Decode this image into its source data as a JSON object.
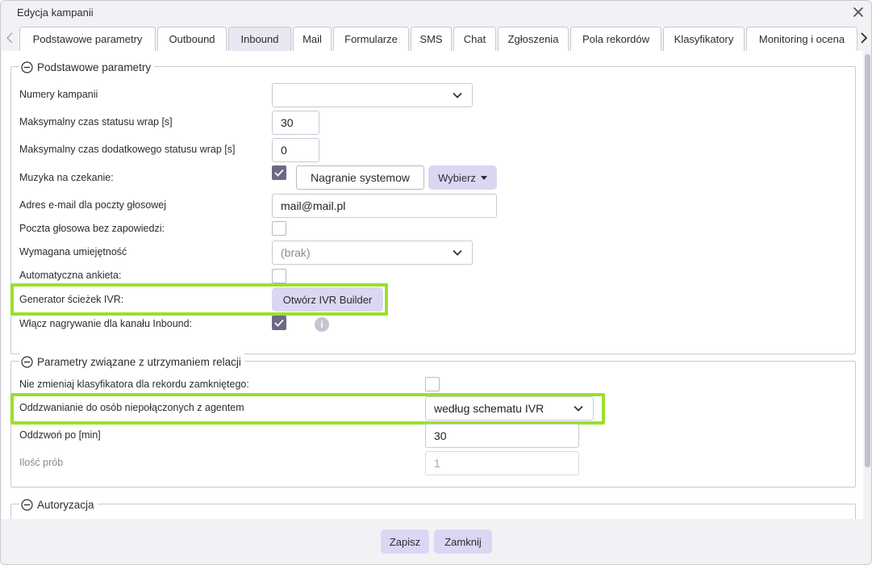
{
  "dialog": {
    "title": "Edycja kampanii"
  },
  "tabs": [
    {
      "label": "Podstawowe parametry",
      "active": false
    },
    {
      "label": "Outbound",
      "active": false
    },
    {
      "label": "Inbound",
      "active": true
    },
    {
      "label": "Mail",
      "active": false
    },
    {
      "label": "Formularze",
      "active": false
    },
    {
      "label": "SMS",
      "active": false
    },
    {
      "label": "Chat",
      "active": false
    },
    {
      "label": "Zgłoszenia",
      "active": false
    },
    {
      "label": "Pola rekordów",
      "active": false
    },
    {
      "label": "Klasyfikatory",
      "active": false
    },
    {
      "label": "Monitoring i ocena",
      "active": false
    }
  ],
  "section_basic": {
    "title": "Podstawowe parametry",
    "numery_label": "Numery kampanii",
    "numery_value": "",
    "wrap_label": "Maksymalny czas statusu wrap [s]",
    "wrap_value": "30",
    "wrap_extra_label": "Maksymalny czas dodatkowego statusu wrap [s]",
    "wrap_extra_value": "0",
    "muzyka_label": "Muzyka na czekanie:",
    "muzyka_checked": true,
    "muzyka_value": "Nagranie systemow",
    "wybierz_label": "Wybierz",
    "email_label": "Adres e-mail dla poczty głosowej",
    "email_value": "mail@mail.pl",
    "poczta_label": "Poczta głosowa bez zapowiedzi:",
    "poczta_checked": false,
    "umiejetnosc_label": "Wymagana umiejętność",
    "umiejetnosc_value": "(brak)",
    "ankieta_label": "Automatyczna ankieta:",
    "ankieta_checked": false,
    "ivr_label": "Generator ścieżek IVR:",
    "ivr_button": "Otwórz IVR Builder",
    "nagrywanie_label": "Włącz nagrywanie dla kanału Inbound:",
    "nagrywanie_checked": true,
    "info_glyph": "i"
  },
  "section_relations": {
    "title": "Parametry związane z utrzymaniem relacji",
    "klasyfikator_label": "Nie zmieniaj klasyfikatora dla rekordu zamkniętego:",
    "klasyfikator_checked": false,
    "oddzwanianie_label": "Oddzwanianie do osób niepołączonych z agentem",
    "oddzwanianie_value": "według schematu IVR",
    "oddzwon_label": "Oddzwoń po [min]",
    "oddzwon_value": "30",
    "proby_label": "Ilość prób",
    "proby_value": "1"
  },
  "section_auth": {
    "title": "Autoryzacja"
  },
  "footer": {
    "save_label": "Zapisz",
    "close_label": "Zamknij"
  },
  "colors": {
    "accent": "#d9d7f1",
    "checkbox_checked": "#6f6885",
    "highlight": "#99e02a",
    "active_tab": "#e8e7f2"
  }
}
